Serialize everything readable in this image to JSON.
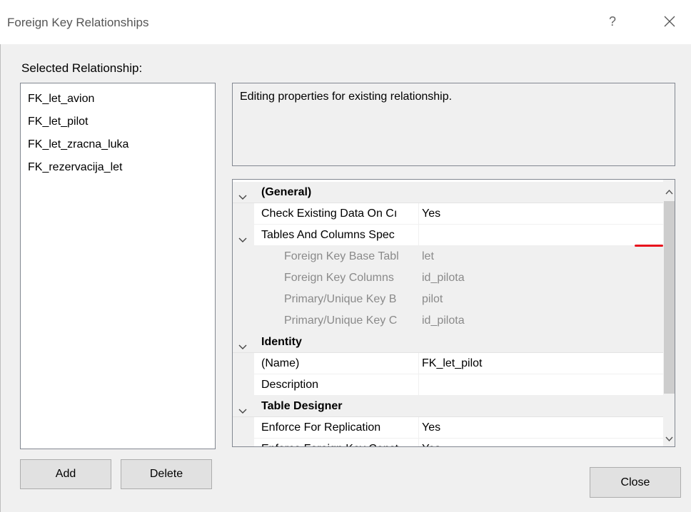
{
  "window": {
    "title": "Foreign Key Relationships",
    "help_label": "?"
  },
  "selected_label": "Selected Relationship:",
  "relationships": [
    "FK_let_avion",
    "FK_let_pilot",
    "FK_let_zracna_luka",
    "FK_rezervacija_let"
  ],
  "description": "Editing properties for existing relationship.",
  "properties": {
    "general": {
      "label": "(General)",
      "check_existing": {
        "name": "Check Existing Data On Cı",
        "value": "Yes"
      },
      "tables_columns": {
        "name": "Tables And Columns Spec",
        "value": ""
      },
      "fk_base_table": {
        "name": "Foreign Key Base Tabl",
        "value": "let"
      },
      "fk_columns": {
        "name": "Foreign Key Columns",
        "value": "id_pilota"
      },
      "pk_base": {
        "name": "Primary/Unique Key B",
        "value": "pilot"
      },
      "pk_columns": {
        "name": "Primary/Unique Key C",
        "value": "id_pilota"
      }
    },
    "identity": {
      "label": "Identity",
      "name_row": {
        "name": "(Name)",
        "value": "FK_let_pilot"
      },
      "description_row": {
        "name": "Description",
        "value": ""
      }
    },
    "table_designer": {
      "label": "Table Designer",
      "enforce_replication": {
        "name": "Enforce For Replication",
        "value": "Yes"
      },
      "enforce_fk": {
        "name": "Enforce Foreign Key Const",
        "value": "Yes"
      }
    }
  },
  "buttons": {
    "add": "Add",
    "delete": "Delete",
    "close": "Close"
  },
  "colors": {
    "annotation_mark": "#e8101c"
  }
}
